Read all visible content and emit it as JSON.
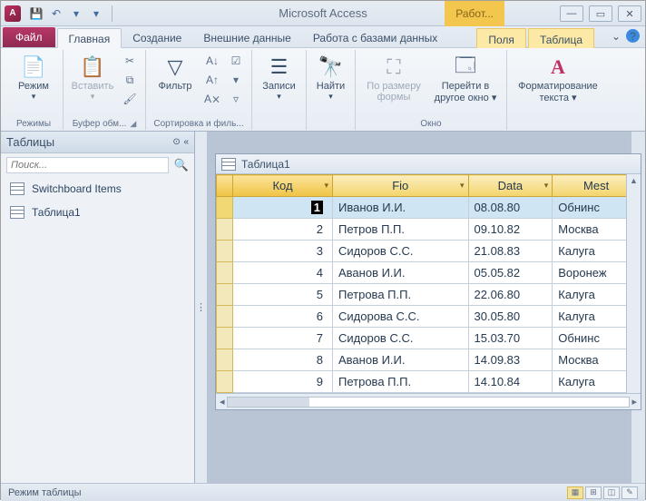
{
  "title": "Microsoft Access",
  "context_title": "Работ...",
  "qat": {
    "save": "💾",
    "undo": "↶",
    "redo": "↷",
    "more": "▾"
  },
  "win": {
    "min": "—",
    "max": "▭",
    "close": "✕"
  },
  "tabs": {
    "file": "Файл",
    "items": [
      "Главная",
      "Создание",
      "Внешние данные",
      "Работа с базами данных"
    ],
    "context": [
      "Поля",
      "Таблица"
    ],
    "collapse": "⌄",
    "help": "?"
  },
  "ribbon": {
    "views": {
      "btn": "Режим",
      "label": "Режимы"
    },
    "clipboard": {
      "paste": "Вставить",
      "label": "Буфер обм..."
    },
    "sortfilter": {
      "filter": "Фильтр",
      "label": "Сортировка и филь..."
    },
    "records": {
      "btn": "Записи",
      "label": ""
    },
    "find": {
      "btn": "Найти",
      "label": ""
    },
    "fitform": {
      "btn1": "По размеру",
      "btn2": "формы"
    },
    "switchwin": {
      "btn1": "Перейти в",
      "btn2": "другое окно",
      "label": "Окно"
    },
    "textfmt": {
      "btn1": "Форматирование",
      "btn2": "текста",
      "glyph": "A"
    }
  },
  "nav": {
    "title": "Таблицы",
    "search_ph": "Поиск...",
    "items": [
      "Switchboard Items",
      "Таблица1"
    ]
  },
  "subwindow": {
    "title": "Таблица1",
    "columns": [
      "Код",
      "Fio",
      "Data",
      "Mest"
    ],
    "rows": [
      {
        "id": "1",
        "fio": "Иванов И.И.",
        "data": "08.08.80",
        "mest": "Обнинс"
      },
      {
        "id": "2",
        "fio": "Петров П.П.",
        "data": "09.10.82",
        "mest": "Москва"
      },
      {
        "id": "3",
        "fio": "Сидоров С.С.",
        "data": "21.08.83",
        "mest": "Калуга"
      },
      {
        "id": "4",
        "fio": "Аванов И.И.",
        "data": "05.05.82",
        "mest": "Воронеж"
      },
      {
        "id": "5",
        "fio": "Петрова П.П.",
        "data": "22.06.80",
        "mest": "Калуга"
      },
      {
        "id": "6",
        "fio": "Сидорова С.С.",
        "data": "30.05.80",
        "mest": "Калуга"
      },
      {
        "id": "7",
        "fio": "Сидоров С.С.",
        "data": "15.03.70",
        "mest": "Обнинс"
      },
      {
        "id": "8",
        "fio": "Аванов И.И.",
        "data": "14.09.83",
        "mest": "Москва"
      },
      {
        "id": "9",
        "fio": "Петрова П.П.",
        "data": "14.10.84",
        "mest": "Калуга"
      }
    ]
  },
  "status": {
    "text": "Режим таблицы"
  }
}
